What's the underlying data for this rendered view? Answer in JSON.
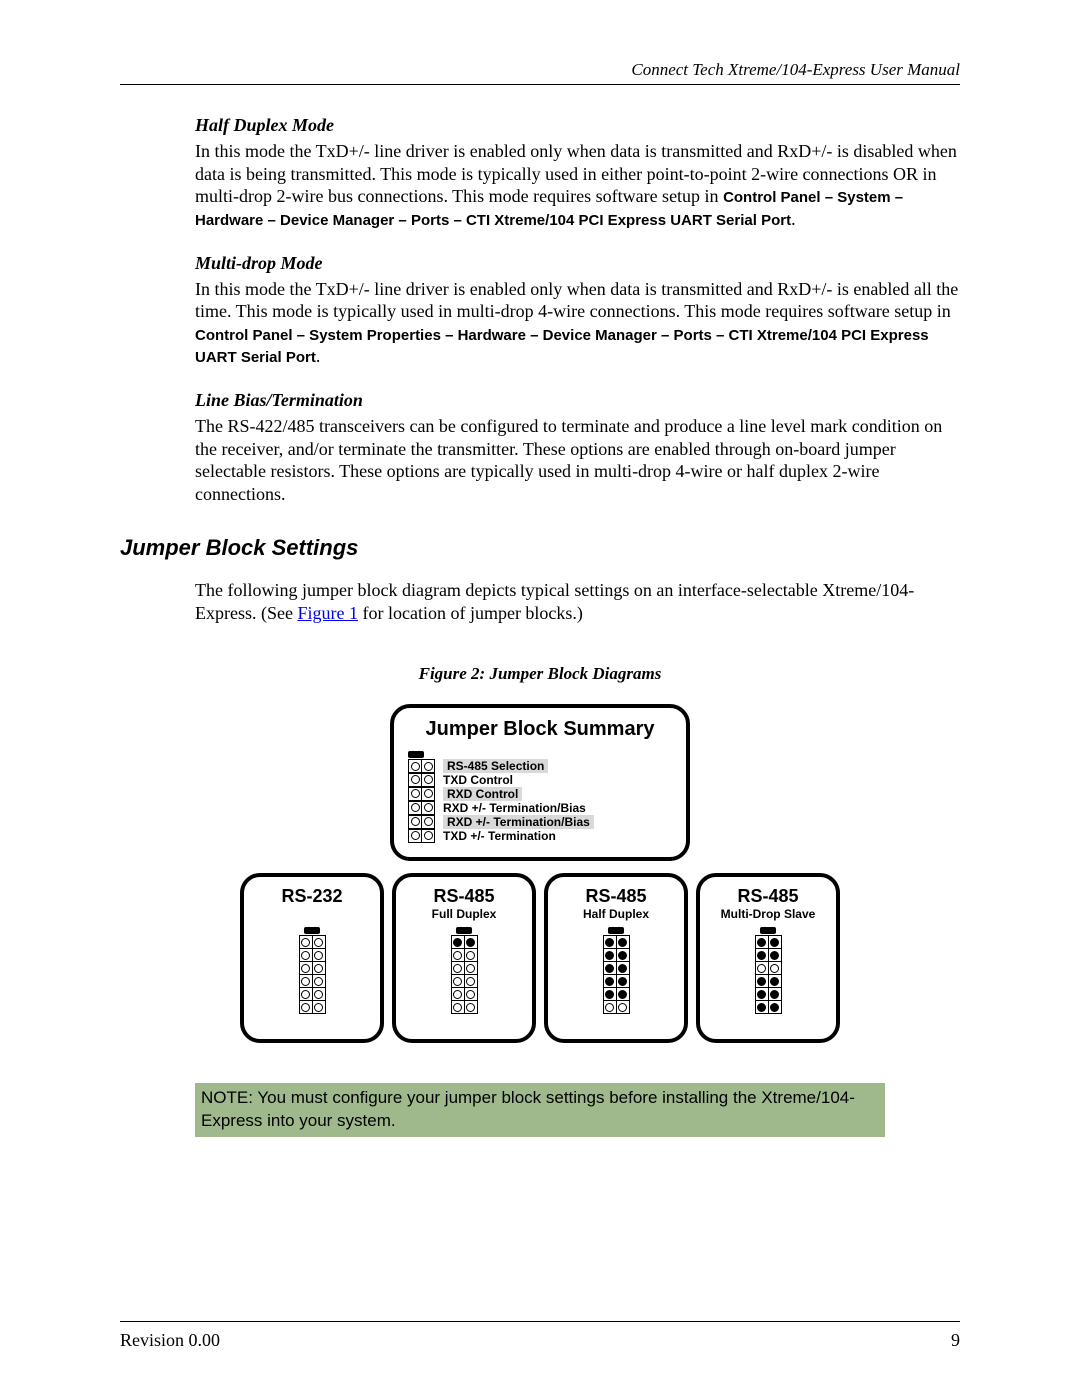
{
  "header": {
    "right": "Connect Tech Xtreme/104-Express User Manual"
  },
  "sections": {
    "halfDuplex": {
      "title": "Half Duplex Mode",
      "text_a": "In this mode the TxD+/- line driver is enabled only when data is transmitted and RxD+/- is disabled when data is being transmitted. This mode is typically used in either point-to-point 2-wire connections OR in multi-drop 2-wire bus connections.  This mode requires software setup in ",
      "text_bold": "Control Panel – System – Hardware – Device Manager – Ports – CTI Xtreme/104 PCI Express UART Serial Port",
      "text_b": "."
    },
    "multiDrop": {
      "title": "Multi-drop Mode",
      "text_a": "In this mode the TxD+/- line driver is enabled only when data is transmitted and RxD+/- is enabled all the time.  This mode is typically used in multi-drop 4-wire connections.  This mode requires software setup in ",
      "text_bold": "Control Panel – System Properties – Hardware – Device Manager – Ports – CTI Xtreme/104 PCI Express UART Serial Port",
      "text_b": "."
    },
    "lineBias": {
      "title": "Line Bias/Termination",
      "text": "The RS-422/485 transceivers can be configured to terminate and produce a line level mark condition on the receiver, and/or terminate the transmitter. These options are enabled through on-board jumper selectable resistors.  These options are typically used in multi-drop 4-wire or half duplex 2-wire connections."
    },
    "jumper": {
      "title": "Jumper Block Settings",
      "text_a": "The following jumper block diagram depicts typical settings on an interface-selectable Xtreme/104-Express. (See ",
      "link": "Figure 1",
      "text_b": " for location of jumper blocks.)"
    }
  },
  "figure": {
    "caption": "Figure 2: Jumper Block Diagrams",
    "summary": {
      "title": "Jumper Block Summary",
      "rows": [
        {
          "label": "RS-485 Selection",
          "shaded": true
        },
        {
          "label": "TXD Control",
          "shaded": false
        },
        {
          "label": "RXD Control",
          "shaded": true
        },
        {
          "label": "RXD +/- Termination/Bias",
          "shaded": false
        },
        {
          "label": "RXD +/- Termination/Bias",
          "shaded": true
        },
        {
          "label": "TXD +/- Termination",
          "shaded": false
        }
      ]
    },
    "blocks": [
      {
        "title": "RS-232",
        "sub": "",
        "pattern": [
          0,
          0,
          0,
          0,
          0,
          0
        ]
      },
      {
        "title": "RS-485",
        "sub": "Full Duplex",
        "pattern": [
          1,
          0,
          0,
          0,
          0,
          0
        ]
      },
      {
        "title": "RS-485",
        "sub": "Half Duplex",
        "pattern": [
          1,
          1,
          1,
          1,
          1,
          0
        ]
      },
      {
        "title": "RS-485",
        "sub": "Multi-Drop Slave",
        "pattern": [
          1,
          1,
          0,
          1,
          1,
          1
        ]
      }
    ]
  },
  "note": "NOTE: You must configure your jumper block settings before installing the Xtreme/104-Express into your system.",
  "footer": {
    "left": "Revision 0.00",
    "right": "9"
  }
}
